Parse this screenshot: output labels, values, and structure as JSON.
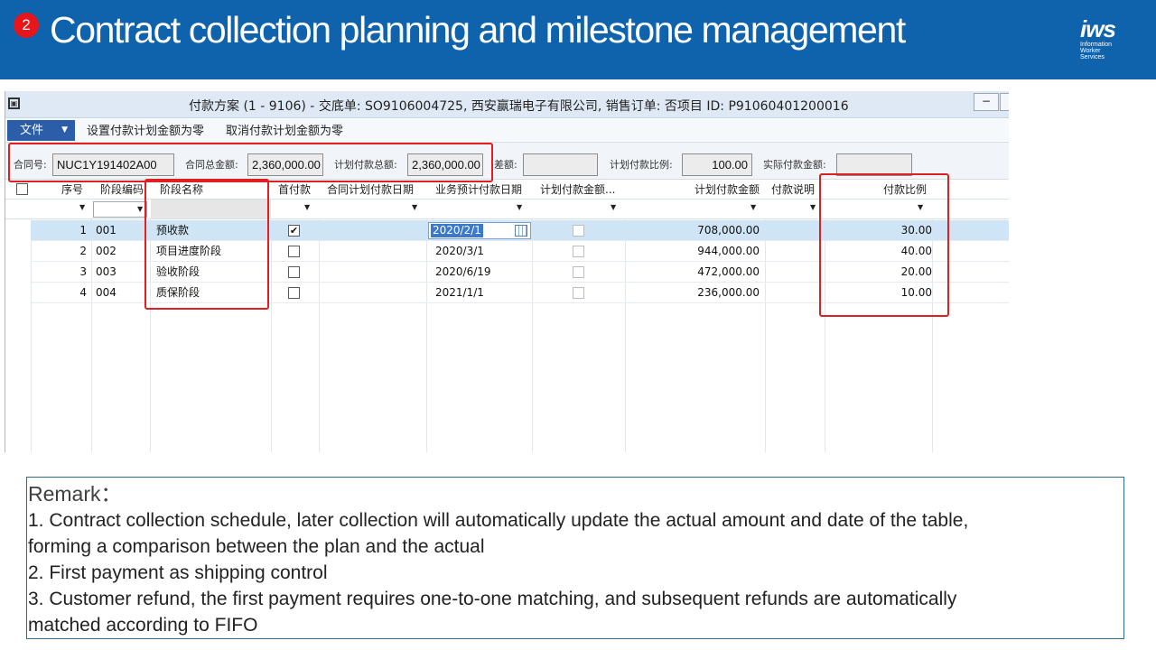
{
  "slide": {
    "step_number": "2",
    "title": "Contract collection planning and milestone management",
    "logo_main": "iws",
    "logo_sub": [
      "Information",
      "Worker",
      "Services"
    ]
  },
  "window": {
    "title": "付款方案 (1 - 9106) - 交底单: SO9106004725, 西安赢瑞电子有限公司, 销售订单: 否项目 ID: P91060401200016",
    "minimize": "−",
    "restore": "▫"
  },
  "menu": {
    "file_label": "文件",
    "set_zero_label": "设置付款计划金额为零",
    "cancel_zero_label": "取消付款计划金额为零"
  },
  "fields": {
    "contract_no_label": "合同号:",
    "contract_no_value": "NUC1Y191402A00",
    "contract_total_label": "合同总金额:",
    "contract_total_value": "2,360,000.00",
    "plan_total_label": "计划付款总额:",
    "plan_total_value": "2,360,000.00",
    "diff_label": "差额:",
    "diff_value": "",
    "plan_ratio_label": "计划付款比例:",
    "plan_ratio_value": "100.00",
    "actual_label": "实际付款金额:",
    "actual_value": ""
  },
  "grid": {
    "columns": [
      "序号",
      "阶段编码",
      "阶段名称",
      "首付款",
      "合同计划付款日期",
      "业务预计付款日期",
      "计划付款金额...",
      "计划付款金额",
      "付款说明",
      "付款比例"
    ],
    "rows": [
      {
        "seq": "1",
        "code": "001",
        "name": "预收款",
        "first_payment": true,
        "contract_date": "",
        "expected_date": "2020/2/1",
        "amount": "708,000.00",
        "note": "",
        "ratio": "30.00"
      },
      {
        "seq": "2",
        "code": "002",
        "name": "项目进度阶段",
        "first_payment": false,
        "contract_date": "",
        "expected_date": "2020/3/1",
        "amount": "944,000.00",
        "note": "",
        "ratio": "40.00"
      },
      {
        "seq": "3",
        "code": "003",
        "name": "验收阶段",
        "first_payment": false,
        "contract_date": "",
        "expected_date": "2020/6/19",
        "amount": "472,000.00",
        "note": "",
        "ratio": "20.00"
      },
      {
        "seq": "4",
        "code": "004",
        "name": "质保阶段",
        "first_payment": false,
        "contract_date": "",
        "expected_date": "2021/1/1",
        "amount": "236,000.00",
        "note": "",
        "ratio": "10.00"
      }
    ]
  },
  "remark": {
    "title": "Remark：",
    "line1": "1. Contract collection schedule, later collection will automatically update the actual amount and date of the table,",
    "line1b": "forming a comparison between the plan and the actual",
    "line2": "2. First payment as shipping control",
    "line3": "3. Customer refund, the first payment requires one-to-one matching, and subsequent refunds are automatically",
    "line3b": "matched according to FIFO"
  },
  "colors": {
    "banner": "#0f63ad",
    "badge": "#e8151b",
    "highlight": "#e02020",
    "selected_row": "#cfe4f5"
  }
}
